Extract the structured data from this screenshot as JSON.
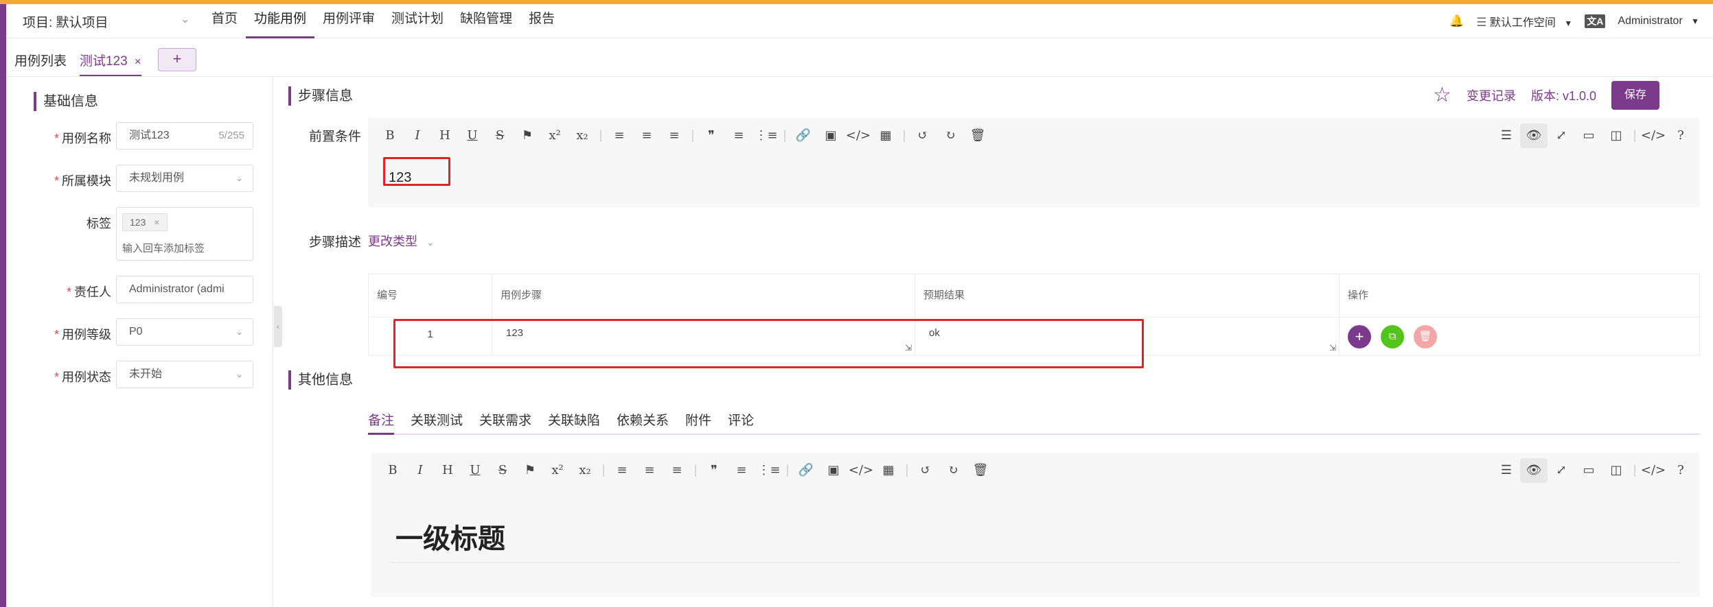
{
  "header": {
    "project_label": "项目: 默认项目",
    "nav": [
      "首页",
      "功能用例",
      "用例评审",
      "测试计划",
      "缺陷管理",
      "报告"
    ],
    "active_nav": 1,
    "workspace": "默认工作空间",
    "user": "Administrator"
  },
  "tabs": {
    "list_tab": "用例列表",
    "open_tab": "测试123",
    "add": "+"
  },
  "basic": {
    "title": "基础信息",
    "fields": [
      {
        "label": "用例名称",
        "required": true,
        "value": "测试123",
        "count": "5/255",
        "type": "text"
      },
      {
        "label": "所属模块",
        "required": true,
        "value": "未规划用例",
        "type": "select"
      },
      {
        "label": "标签",
        "required": false,
        "tags": [
          "123"
        ],
        "placeholder": "输入回车添加标签",
        "type": "tags"
      },
      {
        "label": "责任人",
        "required": true,
        "value": "Administrator (admi",
        "type": "select"
      },
      {
        "label": "用例等级",
        "required": true,
        "value": "P0",
        "type": "select"
      },
      {
        "label": "用例状态",
        "required": true,
        "value": "未开始",
        "type": "select"
      }
    ]
  },
  "steps": {
    "title": "步骤信息",
    "history_link": "变更记录",
    "version": "版本: v1.0.0",
    "save": "保存",
    "precondition_label": "前置条件",
    "precondition_value": "123",
    "desc_label": "步骤描述",
    "change_type": "更改类型",
    "table_headers": [
      "编号",
      "用例步骤",
      "预期结果",
      "操作"
    ],
    "rows": [
      {
        "num": "1",
        "step": "123",
        "expected": "ok"
      }
    ]
  },
  "other": {
    "title": "其他信息",
    "tabs": [
      "备注",
      "关联测试",
      "关联需求",
      "关联缺陷",
      "依赖关系",
      "附件",
      "评论"
    ],
    "active_tab": 0,
    "remark_heading": "一级标题"
  },
  "icons": {
    "toolbar_left": [
      "bold-icon",
      "italic-icon",
      "heading-icon",
      "underline-icon",
      "strikethrough-icon",
      "bookmark-icon",
      "superscript-icon",
      "subscript-icon",
      "align-left-icon",
      "align-center-icon",
      "align-right-icon",
      "quote-icon",
      "ordered-list-icon",
      "unordered-list-icon",
      "link-icon",
      "image-icon",
      "code-icon",
      "table-icon",
      "undo-icon",
      "redo-icon",
      "trash-icon"
    ],
    "toolbar_right": [
      "toc-icon",
      "preview-icon",
      "fullscreen-icon",
      "page-fullscreen-icon",
      "split-view-icon",
      "html-code-icon",
      "help-icon"
    ]
  },
  "colors": {
    "accent": "#7c3a8c",
    "top_stripe": "#f3a73b",
    "highlight_box": "#e02424",
    "add_btn": "#7c3a8c",
    "copy_btn": "#52c41a",
    "delete_btn": "#f4a5a5"
  }
}
